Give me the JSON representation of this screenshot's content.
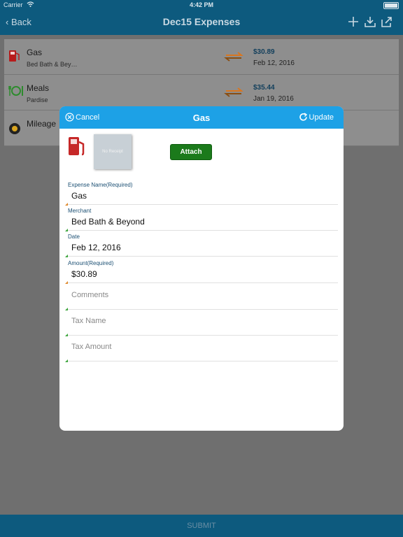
{
  "status_bar": {
    "carrier": "Carrier",
    "time": "4:42 PM"
  },
  "nav": {
    "back_label": "Back",
    "title": "Dec15 Expenses",
    "icons": [
      "add-icon",
      "download-icon",
      "share-icon"
    ]
  },
  "expenses": [
    {
      "title": "Gas",
      "merchant": "Bed Bath & Bey…",
      "amount": "$30.89",
      "date": "Feb 12, 2016",
      "icon": "gas-pump-icon"
    },
    {
      "title": "Meals",
      "merchant": "Pardise",
      "amount": "$35.44",
      "date": "Jan 19, 2016",
      "icon": "meals-icon"
    },
    {
      "title": "Mileage",
      "merchant": "",
      "amount": "",
      "date": "",
      "icon": "mileage-icon"
    }
  ],
  "modal": {
    "cancel_label": "Cancel",
    "title": "Gas",
    "update_label": "Update",
    "receipt_placeholder": "No Receipt",
    "attach_label": "Attach",
    "fields": [
      {
        "label": "Expense Name(Required)",
        "value": "Gas",
        "placeholder": ""
      },
      {
        "label": "Merchant",
        "value": "Bed Bath & Beyond",
        "placeholder": ""
      },
      {
        "label": "Date",
        "value": "Feb 12, 2016",
        "placeholder": ""
      },
      {
        "label": "Amount(Required)",
        "value": "$30.89",
        "placeholder": ""
      },
      {
        "label": "",
        "value": "",
        "placeholder": "Comments"
      },
      {
        "label": "",
        "value": "",
        "placeholder": "Tax Name"
      },
      {
        "label": "",
        "value": "",
        "placeholder": "Tax Amount"
      }
    ]
  },
  "footer": {
    "submit_label": "SUBMIT"
  },
  "colors": {
    "nav": "#0d5a7e",
    "modal_header": "#1da1e6",
    "attach": "#1b7a1b",
    "amount": "#123f5c"
  }
}
